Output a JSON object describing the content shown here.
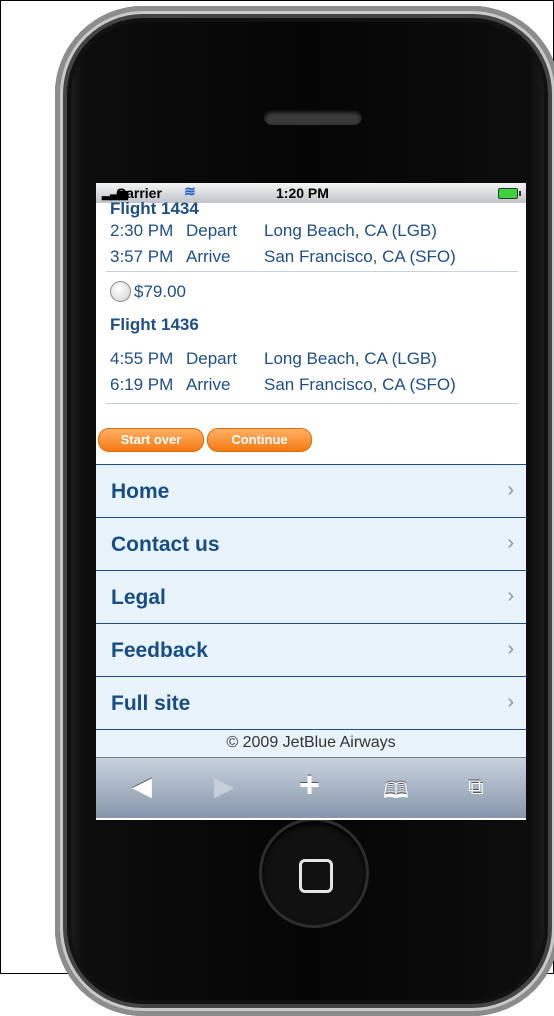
{
  "status_bar": {
    "carrier": "Carrier",
    "time": "1:20 PM"
  },
  "flights": [
    {
      "title": "Flight 1434",
      "depart": {
        "time": "2:30 PM",
        "action": "Depart",
        "place": "Long Beach, CA (LGB)"
      },
      "arrive": {
        "time": "3:57 PM",
        "action": "Arrive",
        "place": "San Francisco, CA (SFO)"
      }
    },
    {
      "title": "Flight 1436",
      "price": "$79.00",
      "depart": {
        "time": "4:55 PM",
        "action": "Depart",
        "place": "Long Beach, CA (LGB)"
      },
      "arrive": {
        "time": "6:19 PM",
        "action": "Arrive",
        "place": "San Francisco, CA (SFO)"
      }
    }
  ],
  "buttons": {
    "start_over": "Start over",
    "continue": "Continue"
  },
  "nav": [
    "Home",
    "Contact us",
    "Legal",
    "Feedback",
    "Full site"
  ],
  "footer": "© 2009 JetBlue Airways",
  "toolbar": {
    "back": "◀",
    "forward": "▶",
    "add": "+",
    "bookmarks": "🕮",
    "pages": "⧉"
  },
  "icons": {
    "signal": "signal-bars-icon",
    "wifi": "wifi-icon",
    "battery": "battery-icon",
    "chevron": "›"
  }
}
